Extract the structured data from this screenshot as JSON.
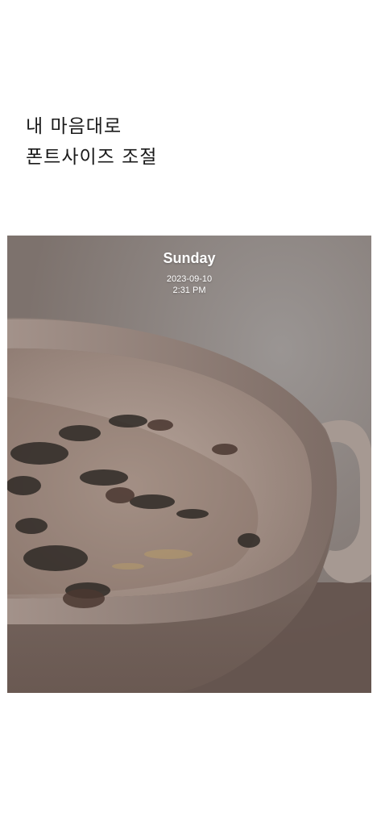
{
  "headline": {
    "line1": "내 마음대로",
    "line2": "폰트사이즈 조절"
  },
  "widget": {
    "day": "Sunday",
    "date": "2023-09-10",
    "time": "2:31 PM"
  }
}
